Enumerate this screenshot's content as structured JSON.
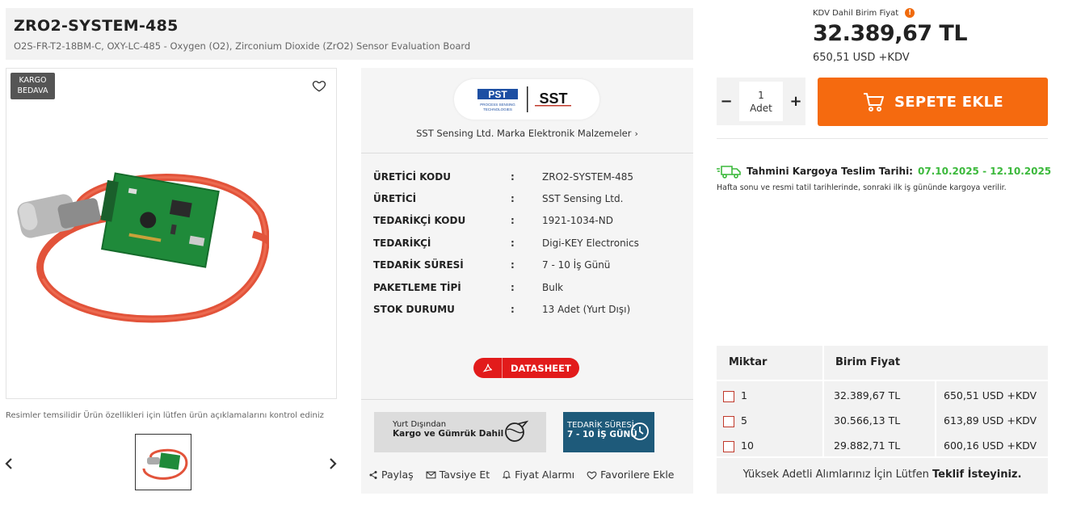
{
  "product": {
    "title": "ZRO2-SYSTEM-485",
    "subtitle": "O2S-FR-T2-18BM-C, OXY-LC-485 - Oxygen (O2), Zirconium Dioxide (ZrO2) Sensor Evaluation Board",
    "badge_line1": "KARGO",
    "badge_line2": "BEDAVA",
    "image_alt": "Oxygen sensor evaluation board with red cable",
    "disclaimer": "Resimler temsilidir Ürün özellikleri için lütfen ürün açıklamalarını kontrol ediniz"
  },
  "brand": {
    "logo_left": "PST",
    "logo_right": "SST",
    "link": "SST Sensing Ltd. Marka Elektronik Malzemeler"
  },
  "specs": [
    {
      "key": "ÜRETİCİ KODU",
      "sep": ":",
      "value": "ZRO2-SYSTEM-485"
    },
    {
      "key": "ÜRETİCİ",
      "sep": ":",
      "value": "SST Sensing Ltd."
    },
    {
      "key": "TEDARİKÇİ KODU",
      "sep": ":",
      "value": "1921-1034-ND"
    },
    {
      "key": "TEDARİKÇİ",
      "sep": ":",
      "value": "Digi-KEY Electronics"
    },
    {
      "key": "TEDARİK SÜRESİ",
      "sep": ":",
      "value": "7 - 10 İş Günü"
    },
    {
      "key": "PAKETLEME TİPİ",
      "sep": ":",
      "value": "Bulk"
    },
    {
      "key": "STOK DURUMU",
      "sep": ":",
      "value": "13 Adet (Yurt Dışı)"
    }
  ],
  "datasheet": {
    "label": "DATASHEET"
  },
  "banners": {
    "cargo_line1": "Yurt Dışından",
    "cargo_line2": "Kargo ve Gümrük Dahil",
    "supply_line1": "TEDARİK SÜRESİ",
    "supply_line2": "7 - 10 İŞ GÜNÜ"
  },
  "share": {
    "share": "Paylaş",
    "recommend": "Tavsiye Et",
    "price_alarm": "Fiyat Alarmı",
    "favorites": "Favorilere Ekle"
  },
  "price": {
    "label": "KDV Dahil Birim Fiyat",
    "warn": "!",
    "main": "32.389,67 TL",
    "usd": "650,51 USD +KDV"
  },
  "cart": {
    "qty_minus": "−",
    "qty_plus": "+",
    "qty_value": "1",
    "qty_unit": "Adet",
    "add_label": "SEPETE EKLE"
  },
  "delivery": {
    "label": "Tahmini Kargoya Teslim Tarihi:",
    "dates": "07.10.2025 - 12.10.2025",
    "note": "Hafta sonu ve resmi tatil tarihlerinde, sonraki ilk iş gününde kargoya verilir."
  },
  "tiers": {
    "head_qty": "Miktar",
    "head_price": "Birim Fiyat",
    "rows": [
      {
        "qty": "1",
        "tl": "32.389,67 TL",
        "usd": "650,51 USD +KDV"
      },
      {
        "qty": "5",
        "tl": "30.566,13 TL",
        "usd": "613,89 USD +KDV"
      },
      {
        "qty": "10",
        "tl": "29.882,71 TL",
        "usd": "600,16 USD +KDV"
      }
    ],
    "foot_text": "Yüksek Adetli Alımlarınız İçin Lütfen",
    "foot_bold": "Teklif İsteyiniz."
  },
  "colors": {
    "accent_orange": "#f56a0f",
    "pdf_red": "#e21b1b",
    "delivery_green": "#3cb93c",
    "supply_blue": "#1e5a7a"
  },
  "icons": [
    "heart-icon",
    "chevron-left-icon",
    "chevron-right-icon",
    "chevron-right-small-icon",
    "pdf-icon",
    "share-icon",
    "mail-icon",
    "bell-icon",
    "cart-icon",
    "truck-icon",
    "clock-icon",
    "warning-icon"
  ]
}
